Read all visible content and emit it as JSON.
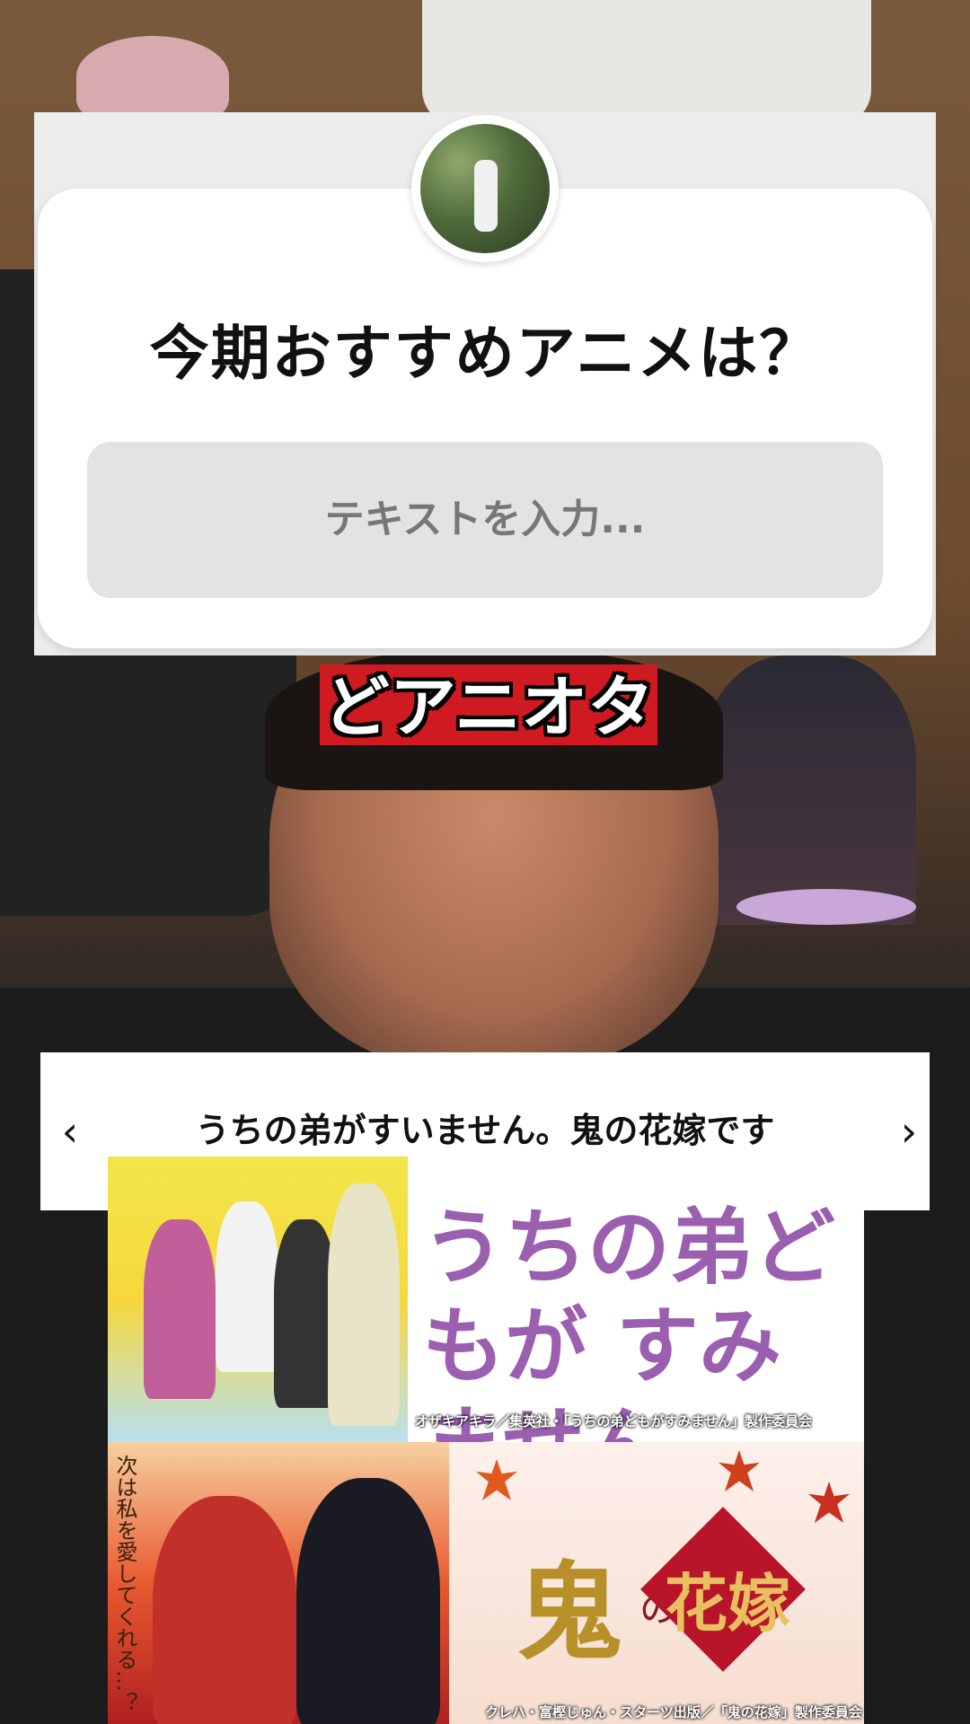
{
  "question_sticker": {
    "question": "今期おすすめアニメは？",
    "placeholder": "テキストを入力..."
  },
  "caption": "どアニオタ",
  "carousel": {
    "title": "うちの弟がすいません。鬼の花嫁です",
    "prev": "‹",
    "next": "›"
  },
  "anime1": {
    "logo": "うちの弟どもが すみません",
    "credit": "オザキアキラ／集英社・「うちの弟どもがすみません」製作委員会"
  },
  "anime2": {
    "logo_oni": "鬼",
    "logo_no": "の",
    "logo_hanayome": "花嫁",
    "vertical_text": "次は私を愛してくれる…？",
    "credit": "クレハ・富樫じゅん・スターツ出版／「鬼の花嫁」製作委員会"
  }
}
